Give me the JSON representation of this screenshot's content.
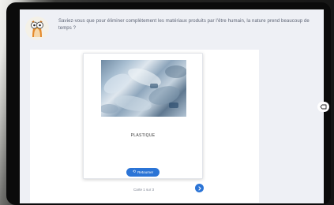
{
  "fact": {
    "text": "Saviez-vous que pour éliminer complètement les matériaux produits par l'être humain, la nature prend beaucoup de temps ?"
  },
  "card": {
    "title": "PLASTIQUE",
    "image_icon": "plastic-bottles-photo",
    "return_label": "Retourner",
    "return_icon": "rotate-icon"
  },
  "pager": {
    "text": "Carte 1 sur 3"
  },
  "colors": {
    "accent": "#2b74d6",
    "screen_bg": "#eef0f5",
    "text": "#5a6172"
  },
  "icons": {
    "next": "chevron-right-icon",
    "back": "back-arrow-icon",
    "mascot": "owl-mascot-icon"
  }
}
